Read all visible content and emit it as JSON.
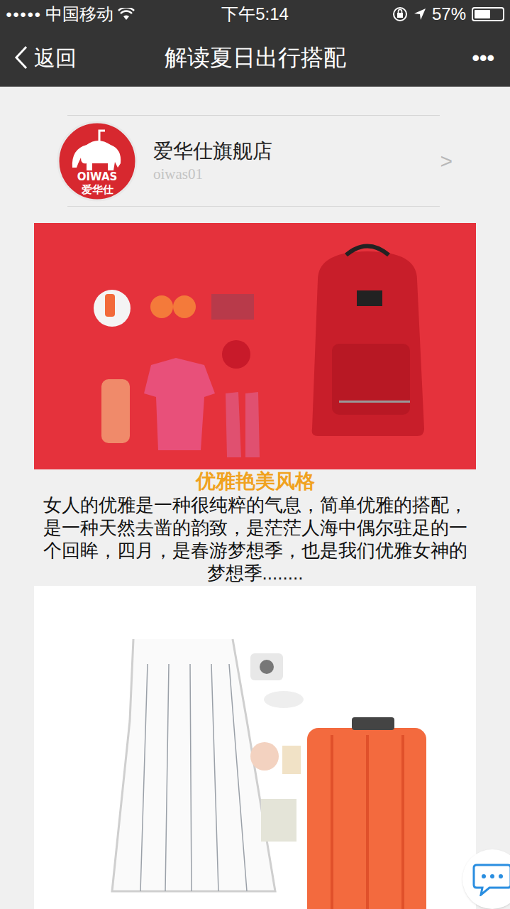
{
  "status_bar": {
    "signal": "●●●●●",
    "carrier": "中国移动",
    "time": "下午5:14",
    "battery": "57%",
    "battery_level": 0.57
  },
  "nav": {
    "back": "返回",
    "title": "解读夏日出行搭配",
    "more": "•••"
  },
  "account": {
    "logo_text": [
      "OIWAS",
      "爱华仕"
    ],
    "name": "爱华仕旗舰店",
    "id": "oiwas01",
    "chevron": ">"
  },
  "article": {
    "heading": "优雅艳美风格",
    "paragraph": "女人的优雅是一种很纯粹的气息，简单优雅的搭配，是一种天然去凿的韵致，是茫茫人海中偶尔驻足的一个回眸，四月，是春游梦想季，也是我们优雅女神的梦想季........"
  }
}
